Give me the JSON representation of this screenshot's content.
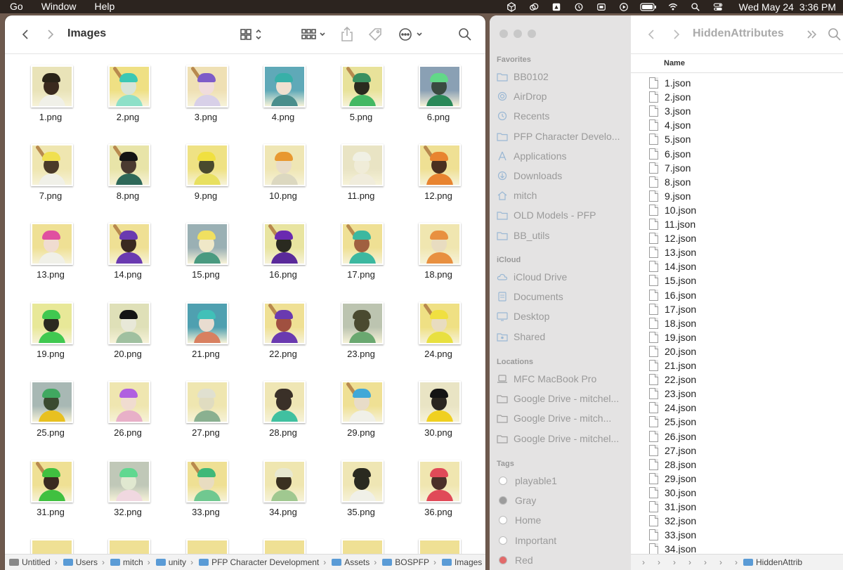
{
  "menubar": {
    "menus": [
      "Go",
      "Window",
      "Help"
    ],
    "clock_day": "Wed May 24",
    "clock_time": "3:36 PM",
    "status_icons": [
      "unity-icon",
      "creative-cloud-icon",
      "drive-icon",
      "sync-icon",
      "screen-icon",
      "play-icon",
      "battery-icon",
      "wifi-icon",
      "spotlight-search-icon",
      "control-center-icon"
    ]
  },
  "window_images": {
    "title": "Images",
    "files": [
      "1.png",
      "2.png",
      "3.png",
      "4.png",
      "5.png",
      "6.png",
      "7.png",
      "8.png",
      "9.png",
      "10.png",
      "11.png",
      "12.png",
      "13.png",
      "14.png",
      "15.png",
      "16.png",
      "17.png",
      "18.png",
      "19.png",
      "20.png",
      "21.png",
      "22.png",
      "23.png",
      "24.png",
      "25.png",
      "26.png",
      "27.png",
      "28.png",
      "29.png",
      "30.png",
      "31.png",
      "32.png",
      "33.png",
      "34.png",
      "35.png",
      "36.png"
    ],
    "path": [
      "Untitled",
      "Users",
      "mitch",
      "unity",
      "PFP Character Development",
      "Assets",
      "BOSPFP",
      "Images"
    ],
    "thumb_colors": [
      {
        "bg": "#e9e3b8",
        "skin": "#3a2a1e",
        "cap": "#2a2418",
        "shirt": "#f0f0e8"
      },
      {
        "bg": "#efe084",
        "skin": "#d8e4d8",
        "cap": "#3cc8b4",
        "shirt": "#8ee0c8"
      },
      {
        "bg": "#efe0b4",
        "skin": "#f0dcdc",
        "cap": "#7e5cc8",
        "shirt": "#d8d0e8"
      },
      {
        "bg": "#5fa9b8",
        "skin": "#f0e0d0",
        "cap": "#38b0a8",
        "shirt": "#4a8e8c"
      },
      {
        "bg": "#e8e29a",
        "skin": "#2a2a1e",
        "cap": "#3a9060",
        "shirt": "#44b864"
      },
      {
        "bg": "#8aa0b4",
        "skin": "#3a4a40",
        "cap": "#62d888",
        "shirt": "#2a8858"
      },
      {
        "bg": "#efe6b0",
        "skin": "#4a3a28",
        "cap": "#f0e050",
        "shirt": "#f0f0e8"
      },
      {
        "bg": "#e8e4a8",
        "skin": "#4a3a30",
        "cap": "#141414",
        "shirt": "#2e6858"
      },
      {
        "bg": "#efe284",
        "skin": "#4a4a2e",
        "cap": "#f0e040",
        "shirt": "#e8e060"
      },
      {
        "bg": "#efe6b4",
        "skin": "#e8dcc8",
        "cap": "#e89830",
        "shirt": "#dcd8c0"
      },
      {
        "bg": "#e9e4c4",
        "skin": "#f0ecd8",
        "cap": "#f0f0e4",
        "shirt": "#f0ecdc"
      },
      {
        "bg": "#efe094",
        "skin": "#4a3020",
        "cap": "#e88430",
        "shirt": "#e88430"
      },
      {
        "bg": "#efe094",
        "skin": "#f0dcd0",
        "cap": "#e050a0",
        "shirt": "#f0f0e8"
      },
      {
        "bg": "#efe094",
        "skin": "#3a2a20",
        "cap": "#6a3ab0",
        "shirt": "#6a3ab0"
      },
      {
        "bg": "#9ab0b4",
        "skin": "#f0e8c8",
        "cap": "#f0e060",
        "shirt": "#4a9a80"
      },
      {
        "bg": "#e8e4a0",
        "skin": "#2a2a20",
        "cap": "#6a2ab0",
        "shirt": "#5a2a9a"
      },
      {
        "bg": "#efe094",
        "skin": "#a06040",
        "cap": "#3cb8a0",
        "shirt": "#3cb8a0"
      },
      {
        "bg": "#f0e6b0",
        "skin": "#e8dcc0",
        "cap": "#e89040",
        "shirt": "#e89040"
      },
      {
        "bg": "#e8e898",
        "skin": "#2a2a20",
        "cap": "#40c850",
        "shirt": "#40c850"
      },
      {
        "bg": "#dfe0b8",
        "skin": "#e8e8d8",
        "cap": "#141414",
        "shirt": "#a0c0a0"
      },
      {
        "bg": "#4fa0b0",
        "skin": "#e8dcd0",
        "cap": "#40c0b8",
        "shirt": "#d88060"
      },
      {
        "bg": "#efe094",
        "skin": "#a05040",
        "cap": "#6a3ab0",
        "shirt": "#6a3ab0"
      },
      {
        "bg": "#bcc4b0",
        "skin": "#4a4a30",
        "cap": "#4a4a30",
        "shirt": "#6aa870"
      },
      {
        "bg": "#efe084",
        "skin": "#e8dcc0",
        "cap": "#f0e040",
        "shirt": "#e8e040"
      },
      {
        "bg": "#a8b8b4",
        "skin": "#3a4a30",
        "cap": "#40a860",
        "shirt": "#e8c020"
      },
      {
        "bg": "#efe6b0",
        "skin": "#f0dcd0",
        "cap": "#b060e0",
        "shirt": "#e8b0c8"
      },
      {
        "bg": "#efe6b0",
        "skin": "#e0dcc0",
        "cap": "#e0e0d0",
        "shirt": "#8ab090"
      },
      {
        "bg": "#efe6b4",
        "skin": "#3a3028",
        "cap": "#3a3028",
        "shirt": "#40c0a0"
      },
      {
        "bg": "#efe094",
        "skin": "#e8dcc8",
        "cap": "#40a8d8",
        "shirt": "#f0f0e8"
      },
      {
        "bg": "#e9e4c4",
        "skin": "#2a2620",
        "cap": "#141414",
        "shirt": "#f0d020"
      },
      {
        "bg": "#efe094",
        "skin": "#3a2a20",
        "cap": "#40c040",
        "shirt": "#40c040"
      },
      {
        "bg": "#c0c8b8",
        "skin": "#e0e8d0",
        "cap": "#60d890",
        "shirt": "#f0d8e0"
      },
      {
        "bg": "#efe094",
        "skin": "#e8dcc0",
        "cap": "#40b878",
        "shirt": "#70c890"
      },
      {
        "bg": "#efe6b0",
        "skin": "#3a3020",
        "cap": "#e8e8d0",
        "shirt": "#a0c890"
      },
      {
        "bg": "#efe6b4",
        "skin": "#2a2a20",
        "cap": "#2a2a20",
        "shirt": "#f0f0e8"
      },
      {
        "bg": "#f0e6b0",
        "skin": "#4a3028",
        "cap": "#e04a58",
        "shirt": "#e04a58"
      }
    ],
    "bat_flags": [
      0,
      1,
      1,
      0,
      1,
      0,
      1,
      1,
      0,
      0,
      0,
      1,
      0,
      1,
      0,
      1,
      1,
      0,
      0,
      0,
      0,
      1,
      0,
      1,
      0,
      0,
      0,
      0,
      1,
      0,
      1,
      0,
      1,
      0,
      0,
      0
    ]
  },
  "window_hidden": {
    "title": "HiddenAttributes",
    "column_name": "Name",
    "favorites_header": "Favorites",
    "favorites": [
      "BB0102",
      "AirDrop",
      "Recents",
      "PFP Character Develo...",
      "Applications",
      "Downloads",
      "mitch",
      "OLD Models - PFP",
      "BB_utils"
    ],
    "icloud_header": "iCloud",
    "icloud": [
      "iCloud Drive",
      "Documents",
      "Desktop",
      "Shared"
    ],
    "locations_header": "Locations",
    "locations": [
      "MFC MacBook Pro",
      "Google Drive - mitchel...",
      "Google Drive - mitch...",
      "Google Drive - mitchel..."
    ],
    "tags_header": "Tags",
    "tags": [
      {
        "label": "playable1",
        "color": "#ffffff"
      },
      {
        "label": "Gray",
        "color": "#9c9c9c"
      },
      {
        "label": "Home",
        "color": "#ffffff"
      },
      {
        "label": "Important",
        "color": "#ffffff"
      },
      {
        "label": "Red",
        "color": "#e26a6a"
      }
    ],
    "files": [
      "1.json",
      "2.json",
      "3.json",
      "4.json",
      "5.json",
      "6.json",
      "7.json",
      "8.json",
      "9.json",
      "10.json",
      "11.json",
      "12.json",
      "13.json",
      "14.json",
      "15.json",
      "16.json",
      "17.json",
      "18.json",
      "19.json",
      "20.json",
      "21.json",
      "22.json",
      "23.json",
      "24.json",
      "25.json",
      "26.json",
      "27.json",
      "28.json",
      "29.json",
      "30.json",
      "31.json",
      "32.json",
      "33.json",
      "34.json"
    ],
    "path_tail": "HiddenAttrib"
  }
}
